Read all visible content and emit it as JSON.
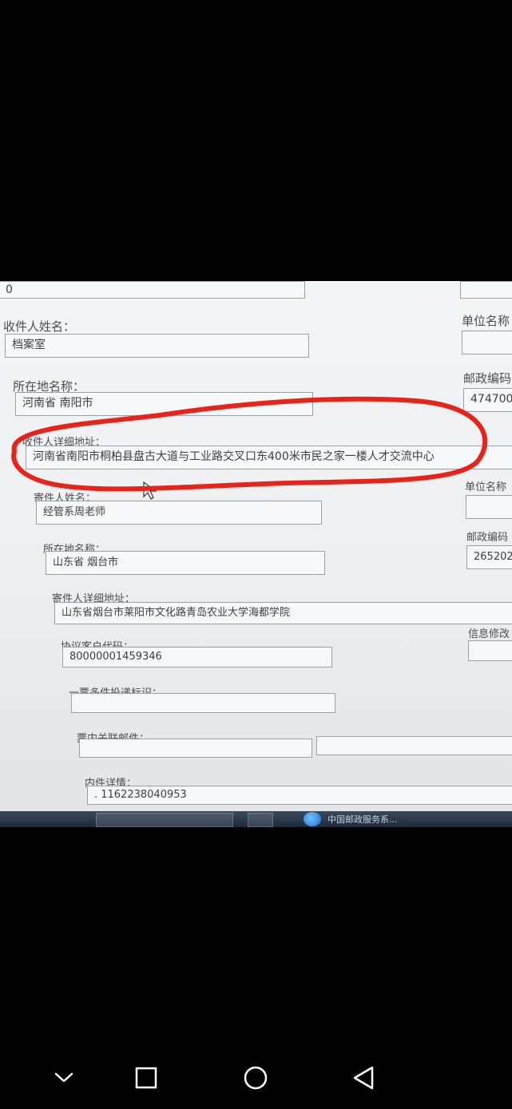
{
  "form": {
    "top_field_value": "0",
    "recipient_name_label": "收件人姓名：",
    "recipient_name_value": "档案室",
    "unit_name_label_1": "单位名称",
    "recipient_location_label": "所在地名称：",
    "recipient_location_value": "河南省 南阳市",
    "postal_code_label_1": "邮政编码",
    "postal_code_value_1": "474700",
    "recipient_address_label": "收件人详细地址：",
    "recipient_address_value": "河南省南阳市桐柏县盘古大道与工业路交叉口东400米市民之家一楼人才交流中心",
    "sender_name_label": "寄件人姓名：",
    "sender_name_value": "经管系周老师",
    "unit_name_label_2": "单位名称",
    "sender_location_label": "所在地名称：",
    "sender_location_value": "山东省 烟台市",
    "postal_code_label_2": "邮政编码",
    "postal_code_value_2": "265202",
    "sender_address_label": "寄件人详细地址：",
    "sender_address_value": "山东省烟台市莱阳市文化路青岛农业大学海都学院",
    "agreement_code_label": "协议客户代码：",
    "agreement_code_value": "80000001459346",
    "info_modify_label": "信息修改",
    "multi_piece_label": "一票多件投递标识：",
    "related_mail_label": "票内关联邮件：",
    "inner_detail_label": "内件详情：",
    "inner_detail_value": ". 1162238040953"
  },
  "taskbar": {
    "window_title": "中国邮政服务系..."
  },
  "annotation": {
    "circle_color": "#e8231a"
  }
}
